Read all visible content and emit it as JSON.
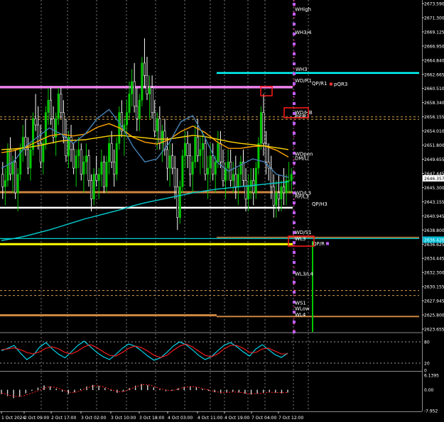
{
  "chart_data": {
    "type": "candlestick",
    "price_axis": {
      "range": [
        2621.5,
        2675.2
      ],
      "ticks": [
        "2673.590",
        "2671.300",
        "2669.125",
        "2666.950",
        "2664.840",
        "2662.665",
        "2660.510",
        "2658.340",
        "2656.155",
        "2654.010",
        "2651.800",
        "2649.655",
        "2647.445",
        "2645.300",
        "2643.155",
        "2640.945",
        "2638.800",
        "2636.625",
        "2634.445",
        "2632.300",
        "2630.155",
        "2627.945",
        "2625.800",
        "2623.655"
      ],
      "current_price": "2646.357",
      "other_price": "2636.426"
    },
    "time_axis": {
      "labels": [
        "1 Oct 2024",
        "2 Oct 09:00",
        "2 Oct 17:00",
        "3 Oct 02:00",
        "3 Oct 10:00",
        "3 Oct 18:00",
        "4 Oct 03:00",
        "4 Oct 11:00",
        "4 Oct 19:00",
        "7 Oct 04:00",
        "7 Oct 12:00"
      ],
      "bar_count": 125
    },
    "candles": [
      [
        2647,
        2649,
        2643,
        2645
      ],
      [
        2645,
        2648,
        2642,
        2646
      ],
      [
        2646,
        2652,
        2645,
        2651
      ],
      [
        2651,
        2653,
        2646,
        2647
      ],
      [
        2647,
        2650,
        2644,
        2649
      ],
      [
        2649,
        2651,
        2643,
        2644
      ],
      [
        2644,
        2648,
        2641,
        2647
      ],
      [
        2647,
        2652,
        2646,
        2651
      ],
      [
        2651,
        2655,
        2649,
        2653
      ],
      [
        2653,
        2656,
        2650,
        2651
      ],
      [
        2651,
        2653,
        2647,
        2648
      ],
      [
        2648,
        2652,
        2646,
        2651
      ],
      [
        2651,
        2657,
        2650,
        2656
      ],
      [
        2656,
        2660,
        2654,
        2655
      ],
      [
        2655,
        2658,
        2651,
        2652
      ],
      [
        2652,
        2655,
        2648,
        2649
      ],
      [
        2649,
        2653,
        2647,
        2652
      ],
      [
        2652,
        2658,
        2651,
        2657
      ],
      [
        2657,
        2661,
        2655,
        2659
      ],
      [
        2659,
        2661,
        2655,
        2656
      ],
      [
        2656,
        2658,
        2652,
        2653
      ],
      [
        2653,
        2657,
        2650,
        2656
      ],
      [
        2656,
        2661,
        2655,
        2660
      ],
      [
        2660,
        2661,
        2656,
        2657
      ],
      [
        2657,
        2659,
        2652,
        2653
      ],
      [
        2653,
        2656,
        2649,
        2650
      ],
      [
        2650,
        2654,
        2648,
        2653
      ],
      [
        2653,
        2655,
        2649,
        2651
      ],
      [
        2651,
        2652,
        2647,
        2648
      ],
      [
        2648,
        2651,
        2645,
        2650
      ],
      [
        2650,
        2653,
        2648,
        2651
      ],
      [
        2651,
        2652,
        2646,
        2647
      ],
      [
        2647,
        2650,
        2644,
        2649
      ],
      [
        2649,
        2652,
        2647,
        2650
      ],
      [
        2650,
        2651,
        2645,
        2646
      ],
      [
        2646,
        2647,
        2641,
        2643
      ],
      [
        2643,
        2648,
        2642,
        2647
      ],
      [
        2647,
        2650,
        2645,
        2646
      ],
      [
        2646,
        2648,
        2643,
        2647
      ],
      [
        2647,
        2651,
        2645,
        2649
      ],
      [
        2649,
        2650,
        2644,
        2645
      ],
      [
        2645,
        2650,
        2644,
        2649
      ],
      [
        2649,
        2653,
        2647,
        2652
      ],
      [
        2652,
        2654,
        2648,
        2649
      ],
      [
        2649,
        2651,
        2645,
        2647
      ],
      [
        2647,
        2653,
        2646,
        2652
      ],
      [
        2652,
        2658,
        2651,
        2657
      ],
      [
        2657,
        2659,
        2653,
        2654
      ],
      [
        2654,
        2656,
        2650,
        2655
      ],
      [
        2655,
        2659,
        2653,
        2657
      ],
      [
        2657,
        2662,
        2656,
        2660
      ],
      [
        2660,
        2664,
        2658,
        2662
      ],
      [
        2662,
        2665,
        2657,
        2658
      ],
      [
        2658,
        2661,
        2654,
        2656
      ],
      [
        2656,
        2660,
        2654,
        2659
      ],
      [
        2659,
        2666,
        2658,
        2665
      ],
      [
        2665,
        2669,
        2661,
        2663
      ],
      [
        2663,
        2666,
        2659,
        2660
      ],
      [
        2660,
        2663,
        2656,
        2661
      ],
      [
        2661,
        2663,
        2656,
        2657
      ],
      [
        2657,
        2659,
        2653,
        2654
      ],
      [
        2654,
        2657,
        2651,
        2656
      ],
      [
        2656,
        2658,
        2651,
        2652
      ],
      [
        2652,
        2655,
        2649,
        2654
      ],
      [
        2654,
        2656,
        2650,
        2651
      ],
      [
        2651,
        2653,
        2646,
        2648
      ],
      [
        2648,
        2652,
        2645,
        2650
      ],
      [
        2650,
        2652,
        2647,
        2648
      ],
      [
        2648,
        2650,
        2643,
        2645
      ],
      [
        2645,
        2648,
        2638,
        2640
      ],
      [
        2640,
        2646,
        2639,
        2645
      ],
      [
        2645,
        2651,
        2644,
        2650
      ],
      [
        2650,
        2654,
        2648,
        2652
      ],
      [
        2652,
        2654,
        2648,
        2650
      ],
      [
        2650,
        2652,
        2645,
        2647
      ],
      [
        2647,
        2650,
        2644,
        2649
      ],
      [
        2649,
        2655,
        2648,
        2653
      ],
      [
        2653,
        2656,
        2649,
        2650
      ],
      [
        2650,
        2653,
        2647,
        2651
      ],
      [
        2651,
        2654,
        2648,
        2652
      ],
      [
        2652,
        2653,
        2646,
        2647
      ],
      [
        2647,
        2650,
        2643,
        2648
      ],
      [
        2648,
        2652,
        2646,
        2650
      ],
      [
        2650,
        2652,
        2646,
        2647
      ],
      [
        2647,
        2650,
        2644,
        2649
      ],
      [
        2649,
        2654,
        2648,
        2652
      ],
      [
        2652,
        2654,
        2648,
        2649
      ],
      [
        2649,
        2651,
        2645,
        2646
      ],
      [
        2646,
        2649,
        2643,
        2648
      ],
      [
        2648,
        2651,
        2646,
        2649
      ],
      [
        2649,
        2651,
        2645,
        2646
      ],
      [
        2646,
        2649,
        2644,
        2647
      ],
      [
        2647,
        2650,
        2643,
        2645
      ],
      [
        2645,
        2648,
        2642,
        2647
      ],
      [
        2647,
        2650,
        2645,
        2649
      ],
      [
        2649,
        2651,
        2645,
        2646
      ],
      [
        2646,
        2648,
        2641,
        2643
      ],
      [
        2643,
        2647,
        2641,
        2645
      ],
      [
        2645,
        2648,
        2643,
        2646
      ],
      [
        2646,
        2648,
        2642,
        2644
      ],
      [
        2644,
        2649,
        2643,
        2648
      ],
      [
        2648,
        2653,
        2647,
        2652
      ],
      [
        2652,
        2658,
        2651,
        2657
      ],
      [
        2657,
        2660,
        2650,
        2652
      ],
      [
        2652,
        2654,
        2647,
        2649
      ],
      [
        2649,
        2652,
        2646,
        2648
      ],
      [
        2648,
        2650,
        2643,
        2645
      ],
      [
        2645,
        2647,
        2640,
        2642
      ],
      [
        2642,
        2646,
        2640,
        2644
      ],
      [
        2644,
        2647,
        2641,
        2643
      ],
      [
        2643,
        2646,
        2641,
        2645
      ],
      [
        2645,
        2648,
        2642,
        2644
      ],
      [
        2644,
        2647,
        2642,
        2646
      ],
      [
        2646,
        2649,
        2644,
        2646
      ],
      [
        2646,
        2648,
        2644,
        2647
      ]
    ],
    "moving_averages": [
      {
        "color": "#ffa500",
        "values": [
          2650.5,
          2650.8,
          2651.4,
          2652.3,
          2653.2,
          2653.5,
          2653.2,
          2653.5,
          2654.6,
          2655.2,
          2654.4,
          2653.0,
          2652.2,
          2651.9,
          2652.6,
          2653.9,
          2654.8,
          2653.8,
          2652.3,
          2651.2,
          2651.2,
          2651.5,
          2651.6,
          2650.9,
          2649.8
        ]
      },
      {
        "color": "#ffd700",
        "values": [
          2651.0,
          2651.1,
          2651.3,
          2651.6,
          2652.0,
          2652.4,
          2652.5,
          2652.6,
          2652.9,
          2653.2,
          2653.3,
          2653.1,
          2652.9,
          2652.7,
          2652.7,
          2653.0,
          2653.3,
          2653.1,
          2652.7,
          2652.3,
          2652.0,
          2651.8,
          2651.6,
          2651.3,
          2651.0
        ]
      },
      {
        "color": "#4682b4",
        "values": [
          2648.0,
          2649.0,
          2651.5,
          2653.0,
          2654.5,
          2653.5,
          2652.0,
          2653.5,
          2656.0,
          2657.5,
          2655.0,
          2651.5,
          2649.0,
          2649.5,
          2652.0,
          2655.5,
          2656.5,
          2653.0,
          2649.0,
          2647.5,
          2648.5,
          2649.5,
          2649.0,
          2647.0,
          2646.5
        ]
      },
      {
        "color": "#00ced1",
        "values": [
          2636.3,
          2636.6,
          2637.0,
          2637.5,
          2638.0,
          2638.6,
          2639.2,
          2639.8,
          2640.3,
          2640.8,
          2641.3,
          2641.9,
          2642.4,
          2642.8,
          2643.2,
          2643.6,
          2644.0,
          2644.3,
          2644.6,
          2644.8,
          2645.0,
          2645.2,
          2645.4,
          2645.6,
          2645.8
        ]
      }
    ],
    "levels": [
      {
        "price": 2661.1,
        "color": "#ee82ee",
        "label": "QP/R1"
      },
      {
        "price": 2663.4,
        "color": "#00ffff",
        "label": "WH3"
      },
      {
        "price": 2641.6,
        "color": "#ffffff",
        "label": "QP/H3"
      },
      {
        "price": 2644.1,
        "color": "#cd853f",
        "label": ""
      },
      {
        "price": 2636.6,
        "color": "#00ced1",
        "label": ""
      },
      {
        "price": 2635.7,
        "color": "#ffff00",
        "label": ""
      },
      {
        "price": 2624.2,
        "color": "#cd853f",
        "label": ""
      }
    ],
    "dotted_levels": [
      2656.3,
      2655.9,
      2628.2,
      2627.4
    ],
    "pivot_labels": [
      {
        "price": 2673.7,
        "text": "WHigh"
      },
      {
        "price": 2670.0,
        "text": "WH3/4"
      },
      {
        "price": 2662.2,
        "text": "WD/R1"
      },
      {
        "price": 2661.6,
        "text": "pQR3"
      },
      {
        "price": 2657.0,
        "text": "WD/HB"
      },
      {
        "price": 2656.4,
        "text": "RP/R3"
      },
      {
        "price": 2650.3,
        "text": "WDpen"
      },
      {
        "price": 2649.6,
        "text": "DM/Li"
      },
      {
        "price": 2644.0,
        "text": "WD/L3"
      },
      {
        "price": 2643.4,
        "text": "RP/L3"
      },
      {
        "price": 2637.6,
        "text": "WD/S1"
      },
      {
        "price": 2636.6,
        "text": "WL3"
      },
      {
        "price": 2635.8,
        "text": "QP/R"
      },
      {
        "price": 2630.9,
        "text": "WL3/L4"
      },
      {
        "price": 2626.2,
        "text": "WS1"
      },
      {
        "price": 2625.3,
        "text": "WLow"
      },
      {
        "price": 2624.3,
        "text": "WL4"
      }
    ],
    "oscillator": {
      "levels": [
        "80",
        "20",
        "0"
      ],
      "range": [
        0,
        100
      ],
      "main": [
        55,
        62,
        70,
        48,
        30,
        42,
        65,
        78,
        60,
        45,
        35,
        52,
        70,
        82,
        66,
        50,
        38,
        30,
        45,
        62,
        74,
        68,
        55,
        40,
        28,
        35,
        50,
        68,
        80,
        72,
        58,
        42,
        30,
        38,
        55,
        70,
        78,
        66,
        52,
        40,
        60,
        72,
        58,
        44,
        36,
        48
      ],
      "signal": [
        58,
        60,
        63,
        58,
        50,
        46,
        52,
        62,
        66,
        60,
        50,
        46,
        54,
        66,
        72,
        64,
        52,
        42,
        40,
        50,
        62,
        68,
        64,
        54,
        42,
        36,
        42,
        56,
        68,
        74,
        66,
        54,
        42,
        38,
        46,
        60,
        70,
        70,
        62,
        50,
        50,
        60,
        62,
        54,
        46,
        46
      ]
    },
    "histogram": {
      "levels": [
        "6.1395",
        "0.00",
        "-7.952"
      ],
      "range": [
        -7.952,
        6.1395
      ],
      "bars": [
        -1.5,
        -2.2,
        -3.0,
        -2.4,
        -1.2,
        -0.3,
        0.8,
        1.6,
        1.2,
        0.4,
        -0.6,
        -1.4,
        -0.8,
        0.3,
        1.2,
        1.8,
        1.4,
        0.6,
        -0.3,
        -1.0,
        -0.5,
        0.6,
        1.5,
        2.1,
        1.7,
        0.9,
        0.2,
        -0.4,
        -0.2,
        0.5,
        1.1,
        1.3,
        0.9,
        0.3,
        -0.3,
        -0.8,
        -1.2,
        -1.0,
        -0.6,
        -0.9,
        -1.3,
        -1.6,
        -1.4,
        -1.1,
        -0.8,
        -1.0,
        -1.2,
        -0.9
      ],
      "signal": [
        -1.2,
        -1.8,
        -2.4,
        -2.5,
        -2.0,
        -1.2,
        -0.4,
        0.6,
        1.1,
        0.8,
        0.0,
        -0.9,
        -1.0,
        -0.4,
        0.6,
        1.4,
        1.5,
        0.9,
        0.1,
        -0.7,
        -0.7,
        0.1,
        1.0,
        1.8,
        1.9,
        1.3,
        0.5,
        -0.2,
        -0.3,
        0.3,
        0.9,
        1.2,
        1.0,
        0.5,
        -0.1,
        -0.6,
        -1.0,
        -1.0,
        -0.8,
        -0.9,
        -1.2,
        -1.5,
        -1.4,
        -1.2,
        -0.9,
        -1.0,
        -1.1,
        -1.0
      ]
    }
  }
}
